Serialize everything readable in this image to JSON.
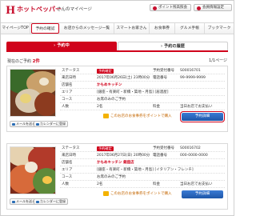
{
  "header": {
    "logo_mark": "H",
    "logo_text": "ホットペッパー",
    "logo_sub": "さんのマイページ",
    "points_button": "ポイント残高照会",
    "member_button": "会員情報設定"
  },
  "nav": {
    "items": [
      {
        "label": "マイページTOP"
      },
      {
        "label": "予約の確認",
        "active": true
      },
      {
        "label": "お店からのメッセージ一覧"
      },
      {
        "label": "スマートお家さん"
      },
      {
        "label": "お食事券"
      },
      {
        "label": "グルメ手帳"
      },
      {
        "label": "ブックマーク"
      }
    ]
  },
  "tabs": {
    "current": "予約中",
    "history": "予約の履歴",
    "chevron": "›"
  },
  "summary": {
    "prefix": "現在のご予約",
    "count": "2件",
    "pager": "1/1ページ"
  },
  "reservations": [
    {
      "status_label": "ステータス",
      "status_value": "予約確定",
      "datetime_label": "来店日時",
      "datetime_value": "2017年06月26日(土) 23時00分",
      "shop_label": "店舗名",
      "shop_value": "かもめキッチン",
      "area_label": "エリア",
      "area_value": "[銀座・有楽町・新橋・築地・月島] [居酒屋]",
      "course_label": "コース",
      "course_value": "お席のみのご予約",
      "people_label": "人数",
      "people_value": "2名",
      "resno_label": "予約受付番号",
      "resno_value": "S00016701",
      "tel_label": "電話番号",
      "tel_value": "99-9999-9999",
      "fee_label": "料金",
      "fee_value": "当日お店でお支払い",
      "mail_button": "メールを送る",
      "calendar_button": "カレンダーに登録",
      "promo_text": "このお店のお食事券をポイントで購入",
      "detail_button": "予約詳細"
    },
    {
      "status_label": "ステータス",
      "status_value": "予約確定",
      "datetime_label": "来店日時",
      "datetime_value": "2017年06月27日(日) 20時00分",
      "shop_label": "店舗名",
      "shop_value": "かもめキッチン 銀座店",
      "area_label": "エリア",
      "area_value": "[銀座・有楽町・新橋・築地・月島] [イタリアン・フレンチ]",
      "course_label": "コース",
      "course_value": "お席のみのご予約",
      "people_label": "人数",
      "people_value": "2名",
      "resno_label": "予約受付番号",
      "resno_value": "S00016702",
      "tel_label": "電話番号",
      "tel_value": "000-0000-0000",
      "fee_label": "料金",
      "fee_value": "当日お店でお支払い",
      "mail_button": "メールを送る",
      "calendar_button": "カレンダーに登録",
      "promo_text": "このお店のお食事券をポイントで購入",
      "detail_button": "予約詳細"
    }
  ],
  "colors": {
    "brand_red": "#d0021b",
    "detail_blue": "#1e56a8",
    "promo_orange": "#c46600"
  }
}
